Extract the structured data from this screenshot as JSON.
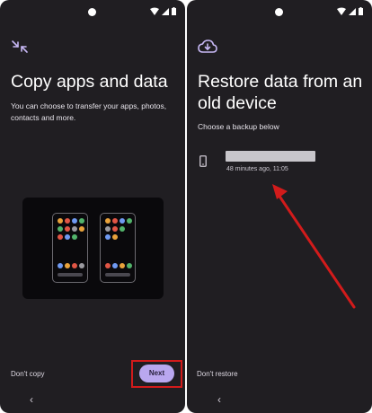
{
  "left_screen": {
    "title": "Copy apps and data",
    "subtitle": "You can choose to transfer your apps, photos, contacts and more.",
    "dont_copy_label": "Don't copy",
    "next_label": "Next",
    "icon": "transfer-arrows-icon"
  },
  "right_screen": {
    "title": "Restore data from an old device",
    "subtitle": "Choose a backup below",
    "backup": {
      "time": "48 minutes ago, 11:05",
      "icon": "smartphone-icon"
    },
    "dont_restore_label": "Don't restore",
    "icon": "cloud-download-icon"
  },
  "navigation": {
    "back_glyph": "‹"
  },
  "colors": {
    "background": "#201e22",
    "accent": "#b9a7ef",
    "highlight": "#d21b1b"
  }
}
